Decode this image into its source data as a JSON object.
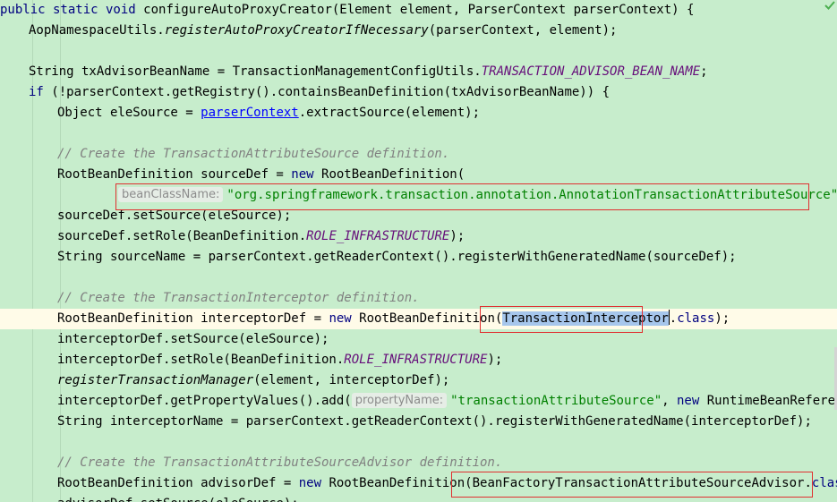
{
  "code": {
    "l1": {
      "kw1": "public static void ",
      "method": "configureAutoProxyCreator",
      "rest": "(Element element, ParserContext parserContext) {"
    },
    "l2": {
      "pre": "AopNamespaceUtils.",
      "call": "registerAutoProxyCreatorIfNecessary",
      "rest": "(parserContext, element);"
    },
    "l4": {
      "pre": "String txAdvisorBeanName = TransactionManagementConfigUtils.",
      "field": "TRANSACTION_ADVISOR_BEAN_NAME",
      "rest": ";"
    },
    "l5": {
      "kw": "if ",
      "rest": "(!parserContext.getRegistry().containsBeanDefinition(txAdvisorBeanName)) {"
    },
    "l6": {
      "pre": "Object eleSource = ",
      "link": "parserContext",
      "rest": ".extractSource(element);"
    },
    "l8": "// Create the TransactionAttributeSource definition.",
    "l9": {
      "pre": "RootBeanDefinition sourceDef = ",
      "kw": "new ",
      "rest": "RootBeanDefinition("
    },
    "l10": {
      "hint": "beanClassName:",
      "str": "\"org.springframework.transaction.annotation.AnnotationTransactionAttributeSource\"",
      "rest": ");"
    },
    "l11": "sourceDef.setSource(eleSource);",
    "l12": {
      "pre": "sourceDef.setRole(BeanDefinition.",
      "field": "ROLE_INFRASTRUCTURE",
      "rest": ");"
    },
    "l13": "String sourceName = parserContext.getReaderContext().registerWithGeneratedName(sourceDef);",
    "l15": "// Create the TransactionInterceptor definition.",
    "l16": {
      "pre": "RootBeanDefinition interceptorDef = ",
      "kw": "new ",
      "mid": "RootBeanDefinition(",
      "sel": "TransactionInterceptor",
      "dot": ".",
      "kw2": "class",
      "rest": ");"
    },
    "l17": "interceptorDef.setSource(eleSource);",
    "l18": {
      "pre": "interceptorDef.setRole(BeanDefinition.",
      "field": "ROLE_INFRASTRUCTURE",
      "rest": ");"
    },
    "l19": {
      "call": "registerTransactionManager",
      "rest": "(element, interceptorDef);"
    },
    "l20": {
      "pre": "interceptorDef.getPropertyValues().add(",
      "hint": "propertyName:",
      "str": "\"transactionAttributeSource\"",
      "mid": ", ",
      "kw": "new ",
      "rest": "RuntimeBeanReference(s"
    },
    "l21": "String interceptorName = parserContext.getReaderContext().registerWithGeneratedName(interceptorDef);",
    "l23": "// Create the TransactionAttributeSourceAdvisor definition.",
    "l24": {
      "pre": "RootBeanDefinition advisorDef = ",
      "kw": "new ",
      "mid": "RootBeanDefinition(",
      "name": "BeanFactoryTransactionAttributeSourceAdvisor",
      "dot": ".",
      "kw2": "class",
      "rest": ");"
    },
    "l25": "advisorDef.setSource(eleSource);"
  },
  "colors": {
    "background": "#c7edcc",
    "keyword": "#000080",
    "string": "#008000",
    "comment": "#808080",
    "field": "#660e7a",
    "highlight_box": "#e03030",
    "selection": "#a6c6ec"
  },
  "icons": {
    "status": "check-icon"
  }
}
